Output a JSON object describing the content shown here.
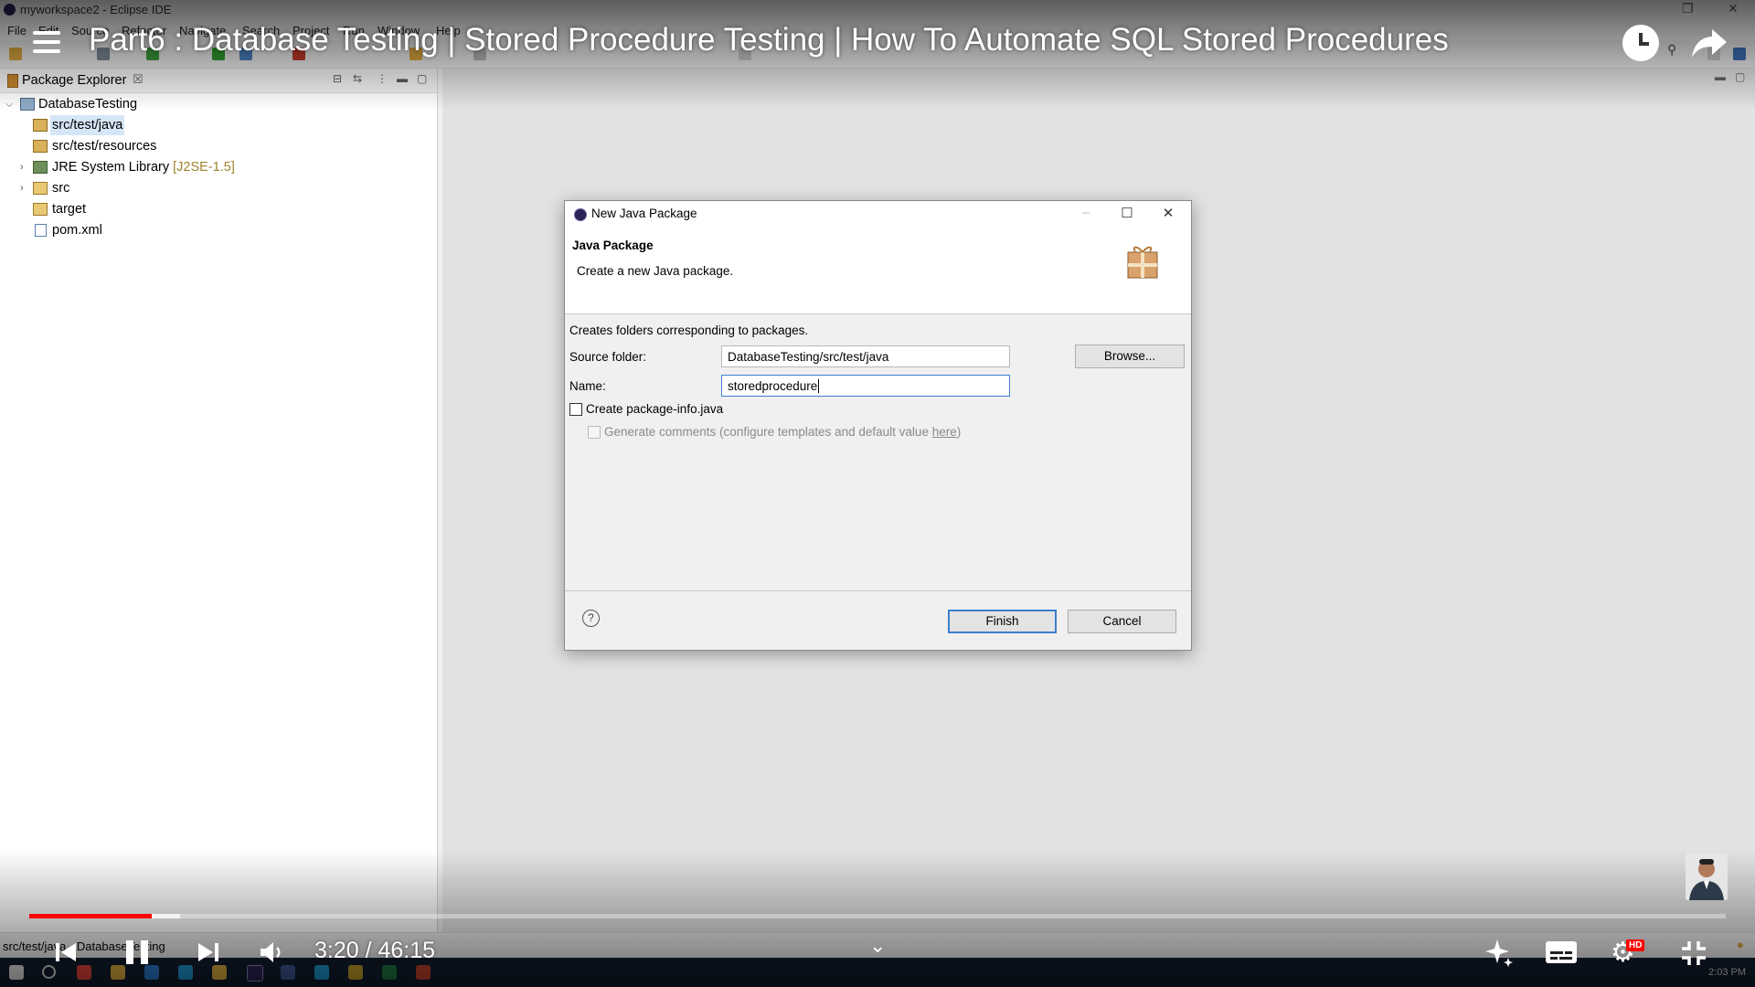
{
  "eclipse": {
    "window_title": "myworkspace2 - Eclipse IDE",
    "menu": [
      "File",
      "Edit",
      "Source",
      "Refactor",
      "Navigate",
      "Search",
      "Project",
      "Run",
      "Window",
      "Help"
    ],
    "package_explorer": {
      "title": "Package Explorer",
      "close_glyph": "☒",
      "tree": [
        {
          "label": "DatabaseTesting",
          "level": 0,
          "expanded": true,
          "icon": "project-icon"
        },
        {
          "label": "src/test/java",
          "level": 1,
          "selected": true,
          "icon": "source-folder-icon"
        },
        {
          "label": "src/test/resources",
          "level": 1,
          "icon": "source-folder-icon"
        },
        {
          "label": "JRE System Library",
          "decoration": "[J2SE-1.5]",
          "level": 1,
          "collapsed": true,
          "icon": "library-icon"
        },
        {
          "label": "src",
          "level": 1,
          "collapsed": true,
          "icon": "folder-icon"
        },
        {
          "label": "target",
          "level": 1,
          "icon": "folder-icon"
        },
        {
          "label": "pom.xml",
          "level": 1,
          "icon": "xml-file-icon"
        }
      ]
    },
    "status_bar": {
      "text": "src/test/java - DatabaseTesting"
    }
  },
  "dialog": {
    "title": "New Java Package",
    "header_title": "Java Package",
    "header_desc": "Create a new Java package.",
    "intro": "Creates folders corresponding to packages.",
    "source_folder_label": "Source folder:",
    "source_folder_value": "DatabaseTesting/src/test/java",
    "browse_label": "Browse...",
    "name_label": "Name:",
    "name_value": "storedprocedure",
    "create_info_label": "Create package-info.java",
    "create_info_checked": false,
    "gen_comments_prefix": "Generate comments (configure templates and default value ",
    "gen_comments_link": "here",
    "gen_comments_suffix": ")",
    "gen_comments_enabled": false,
    "finish_label": "Finish",
    "cancel_label": "Cancel"
  },
  "video": {
    "title": "Part6 : Database Testing | Stored Procedure Testing | How To Automate SQL Stored Procedures",
    "current_time": "3:20",
    "duration": "46:15",
    "time_display": "3:20 / 46:15",
    "progress_fraction": 0.072,
    "buffered_fraction": 0.089,
    "quality_badge": "HD",
    "accent_color": "#ff0000"
  },
  "taskbar": {
    "clock": "2:03 PM"
  }
}
